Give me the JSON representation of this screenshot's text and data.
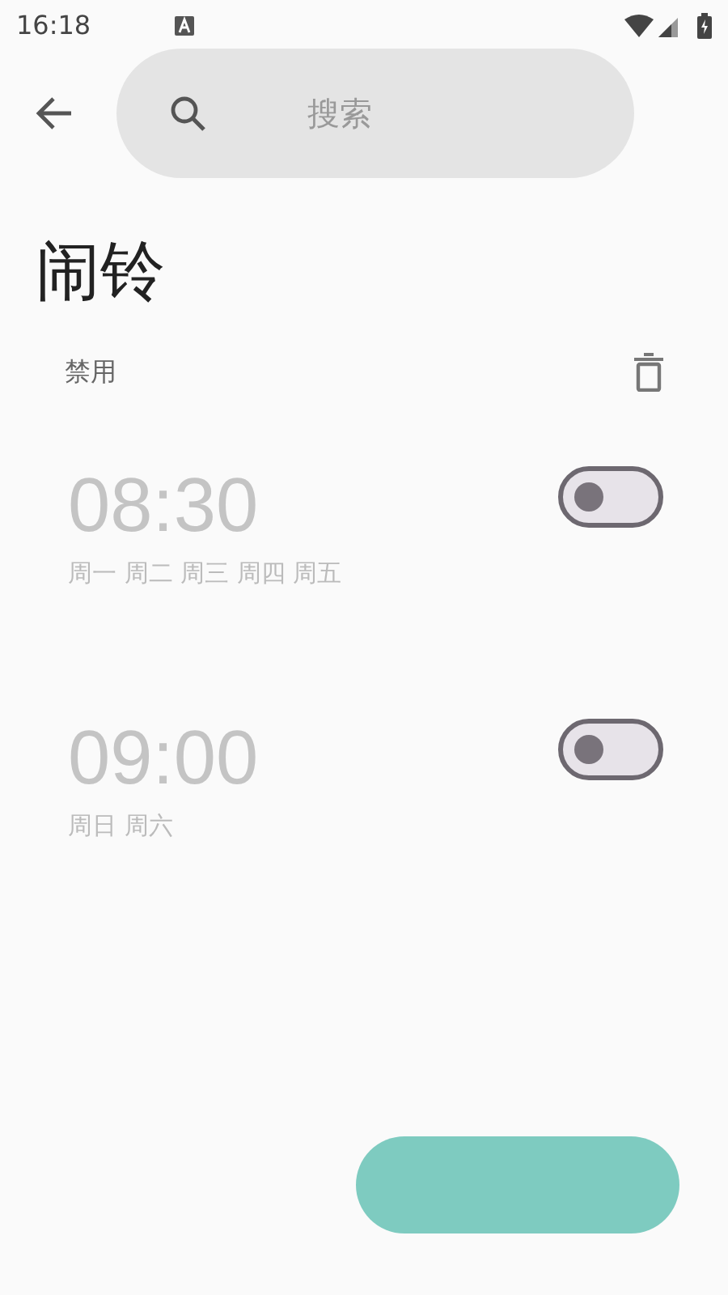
{
  "status_bar": {
    "time": "16:18"
  },
  "search": {
    "placeholder": "搜索"
  },
  "title": "闹铃",
  "section": {
    "label": "禁用"
  },
  "alarms": [
    {
      "time": "08:30",
      "days": "周一 周二 周三 周四 周五",
      "on": false
    },
    {
      "time": "09:00",
      "days": "周日 周六",
      "on": false
    }
  ]
}
